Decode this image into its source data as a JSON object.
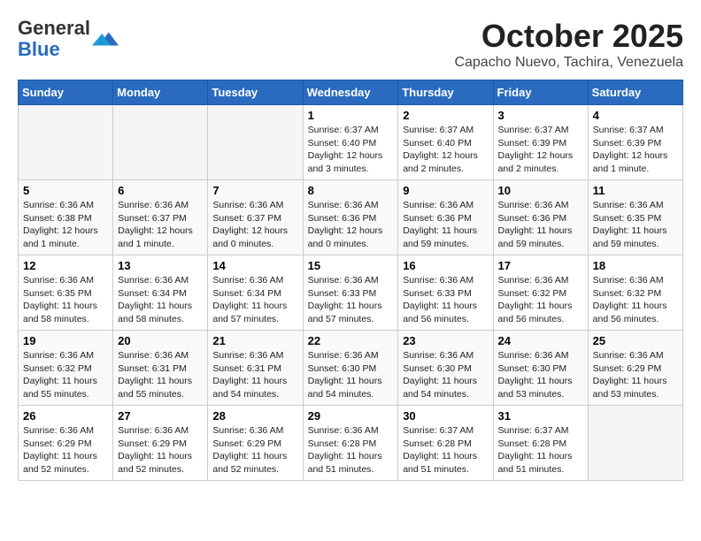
{
  "header": {
    "logo_general": "General",
    "logo_blue": "Blue",
    "month": "October 2025",
    "location": "Capacho Nuevo, Tachira, Venezuela"
  },
  "days_of_week": [
    "Sunday",
    "Monday",
    "Tuesday",
    "Wednesday",
    "Thursday",
    "Friday",
    "Saturday"
  ],
  "weeks": [
    [
      {
        "day": "",
        "info": ""
      },
      {
        "day": "",
        "info": ""
      },
      {
        "day": "",
        "info": ""
      },
      {
        "day": "1",
        "info": "Sunrise: 6:37 AM\nSunset: 6:40 PM\nDaylight: 12 hours and 3 minutes."
      },
      {
        "day": "2",
        "info": "Sunrise: 6:37 AM\nSunset: 6:40 PM\nDaylight: 12 hours and 2 minutes."
      },
      {
        "day": "3",
        "info": "Sunrise: 6:37 AM\nSunset: 6:39 PM\nDaylight: 12 hours and 2 minutes."
      },
      {
        "day": "4",
        "info": "Sunrise: 6:37 AM\nSunset: 6:39 PM\nDaylight: 12 hours and 1 minute."
      }
    ],
    [
      {
        "day": "5",
        "info": "Sunrise: 6:36 AM\nSunset: 6:38 PM\nDaylight: 12 hours and 1 minute."
      },
      {
        "day": "6",
        "info": "Sunrise: 6:36 AM\nSunset: 6:37 PM\nDaylight: 12 hours and 1 minute."
      },
      {
        "day": "7",
        "info": "Sunrise: 6:36 AM\nSunset: 6:37 PM\nDaylight: 12 hours and 0 minutes."
      },
      {
        "day": "8",
        "info": "Sunrise: 6:36 AM\nSunset: 6:36 PM\nDaylight: 12 hours and 0 minutes."
      },
      {
        "day": "9",
        "info": "Sunrise: 6:36 AM\nSunset: 6:36 PM\nDaylight: 11 hours and 59 minutes."
      },
      {
        "day": "10",
        "info": "Sunrise: 6:36 AM\nSunset: 6:36 PM\nDaylight: 11 hours and 59 minutes."
      },
      {
        "day": "11",
        "info": "Sunrise: 6:36 AM\nSunset: 6:35 PM\nDaylight: 11 hours and 59 minutes."
      }
    ],
    [
      {
        "day": "12",
        "info": "Sunrise: 6:36 AM\nSunset: 6:35 PM\nDaylight: 11 hours and 58 minutes."
      },
      {
        "day": "13",
        "info": "Sunrise: 6:36 AM\nSunset: 6:34 PM\nDaylight: 11 hours and 58 minutes."
      },
      {
        "day": "14",
        "info": "Sunrise: 6:36 AM\nSunset: 6:34 PM\nDaylight: 11 hours and 57 minutes."
      },
      {
        "day": "15",
        "info": "Sunrise: 6:36 AM\nSunset: 6:33 PM\nDaylight: 11 hours and 57 minutes."
      },
      {
        "day": "16",
        "info": "Sunrise: 6:36 AM\nSunset: 6:33 PM\nDaylight: 11 hours and 56 minutes."
      },
      {
        "day": "17",
        "info": "Sunrise: 6:36 AM\nSunset: 6:32 PM\nDaylight: 11 hours and 56 minutes."
      },
      {
        "day": "18",
        "info": "Sunrise: 6:36 AM\nSunset: 6:32 PM\nDaylight: 11 hours and 56 minutes."
      }
    ],
    [
      {
        "day": "19",
        "info": "Sunrise: 6:36 AM\nSunset: 6:32 PM\nDaylight: 11 hours and 55 minutes."
      },
      {
        "day": "20",
        "info": "Sunrise: 6:36 AM\nSunset: 6:31 PM\nDaylight: 11 hours and 55 minutes."
      },
      {
        "day": "21",
        "info": "Sunrise: 6:36 AM\nSunset: 6:31 PM\nDaylight: 11 hours and 54 minutes."
      },
      {
        "day": "22",
        "info": "Sunrise: 6:36 AM\nSunset: 6:30 PM\nDaylight: 11 hours and 54 minutes."
      },
      {
        "day": "23",
        "info": "Sunrise: 6:36 AM\nSunset: 6:30 PM\nDaylight: 11 hours and 54 minutes."
      },
      {
        "day": "24",
        "info": "Sunrise: 6:36 AM\nSunset: 6:30 PM\nDaylight: 11 hours and 53 minutes."
      },
      {
        "day": "25",
        "info": "Sunrise: 6:36 AM\nSunset: 6:29 PM\nDaylight: 11 hours and 53 minutes."
      }
    ],
    [
      {
        "day": "26",
        "info": "Sunrise: 6:36 AM\nSunset: 6:29 PM\nDaylight: 11 hours and 52 minutes."
      },
      {
        "day": "27",
        "info": "Sunrise: 6:36 AM\nSunset: 6:29 PM\nDaylight: 11 hours and 52 minutes."
      },
      {
        "day": "28",
        "info": "Sunrise: 6:36 AM\nSunset: 6:29 PM\nDaylight: 11 hours and 52 minutes."
      },
      {
        "day": "29",
        "info": "Sunrise: 6:36 AM\nSunset: 6:28 PM\nDaylight: 11 hours and 51 minutes."
      },
      {
        "day": "30",
        "info": "Sunrise: 6:37 AM\nSunset: 6:28 PM\nDaylight: 11 hours and 51 minutes."
      },
      {
        "day": "31",
        "info": "Sunrise: 6:37 AM\nSunset: 6:28 PM\nDaylight: 11 hours and 51 minutes."
      },
      {
        "day": "",
        "info": ""
      }
    ]
  ]
}
